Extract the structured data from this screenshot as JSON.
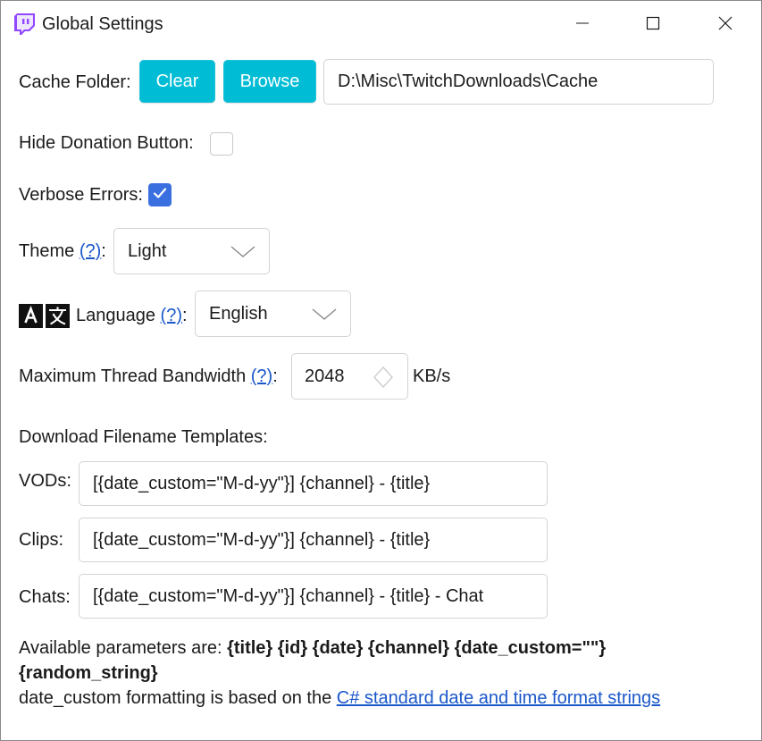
{
  "window": {
    "title": "Global Settings"
  },
  "cache": {
    "label": "Cache Folder:",
    "clear_label": "Clear",
    "browse_label": "Browse",
    "path": "D:\\Misc\\TwitchDownloads\\Cache"
  },
  "donation": {
    "label": "Hide Donation Button:",
    "checked": false
  },
  "verbose": {
    "label": "Verbose Errors:",
    "checked": true
  },
  "theme": {
    "label": "Theme",
    "help": "(?)",
    "colon": ":",
    "value": "Light"
  },
  "language": {
    "label": "Language",
    "help": "(?)",
    "colon": ":",
    "value": "English"
  },
  "bandwidth": {
    "label": "Maximum Thread Bandwidth",
    "help": "(?)",
    "colon": ":",
    "value": "2048",
    "unit": "KB/s"
  },
  "templates": {
    "heading": "Download Filename Templates:",
    "vods_label": "VODs:",
    "vods_value": "[{date_custom=\"M-d-yy\"}] {channel} - {title}",
    "clips_label": "Clips:",
    "clips_value": "[{date_custom=\"M-d-yy\"}] {channel} - {title}",
    "chats_label": "Chats:",
    "chats_value": "[{date_custom=\"M-d-yy\"}] {channel} - {title} - Chat"
  },
  "footer": {
    "params_prefix": "Available parameters are: ",
    "params_line1": "{title} {id} {date} {channel} {date_custom=\"\"}",
    "params_line2": "{random_string}",
    "format_prefix": "date_custom formatting is based on the ",
    "format_link": "C# standard date and time format strings"
  },
  "colors": {
    "accent": "#00bcd4",
    "checkbox": "#3a6fe0",
    "link": "#1a57c9"
  }
}
